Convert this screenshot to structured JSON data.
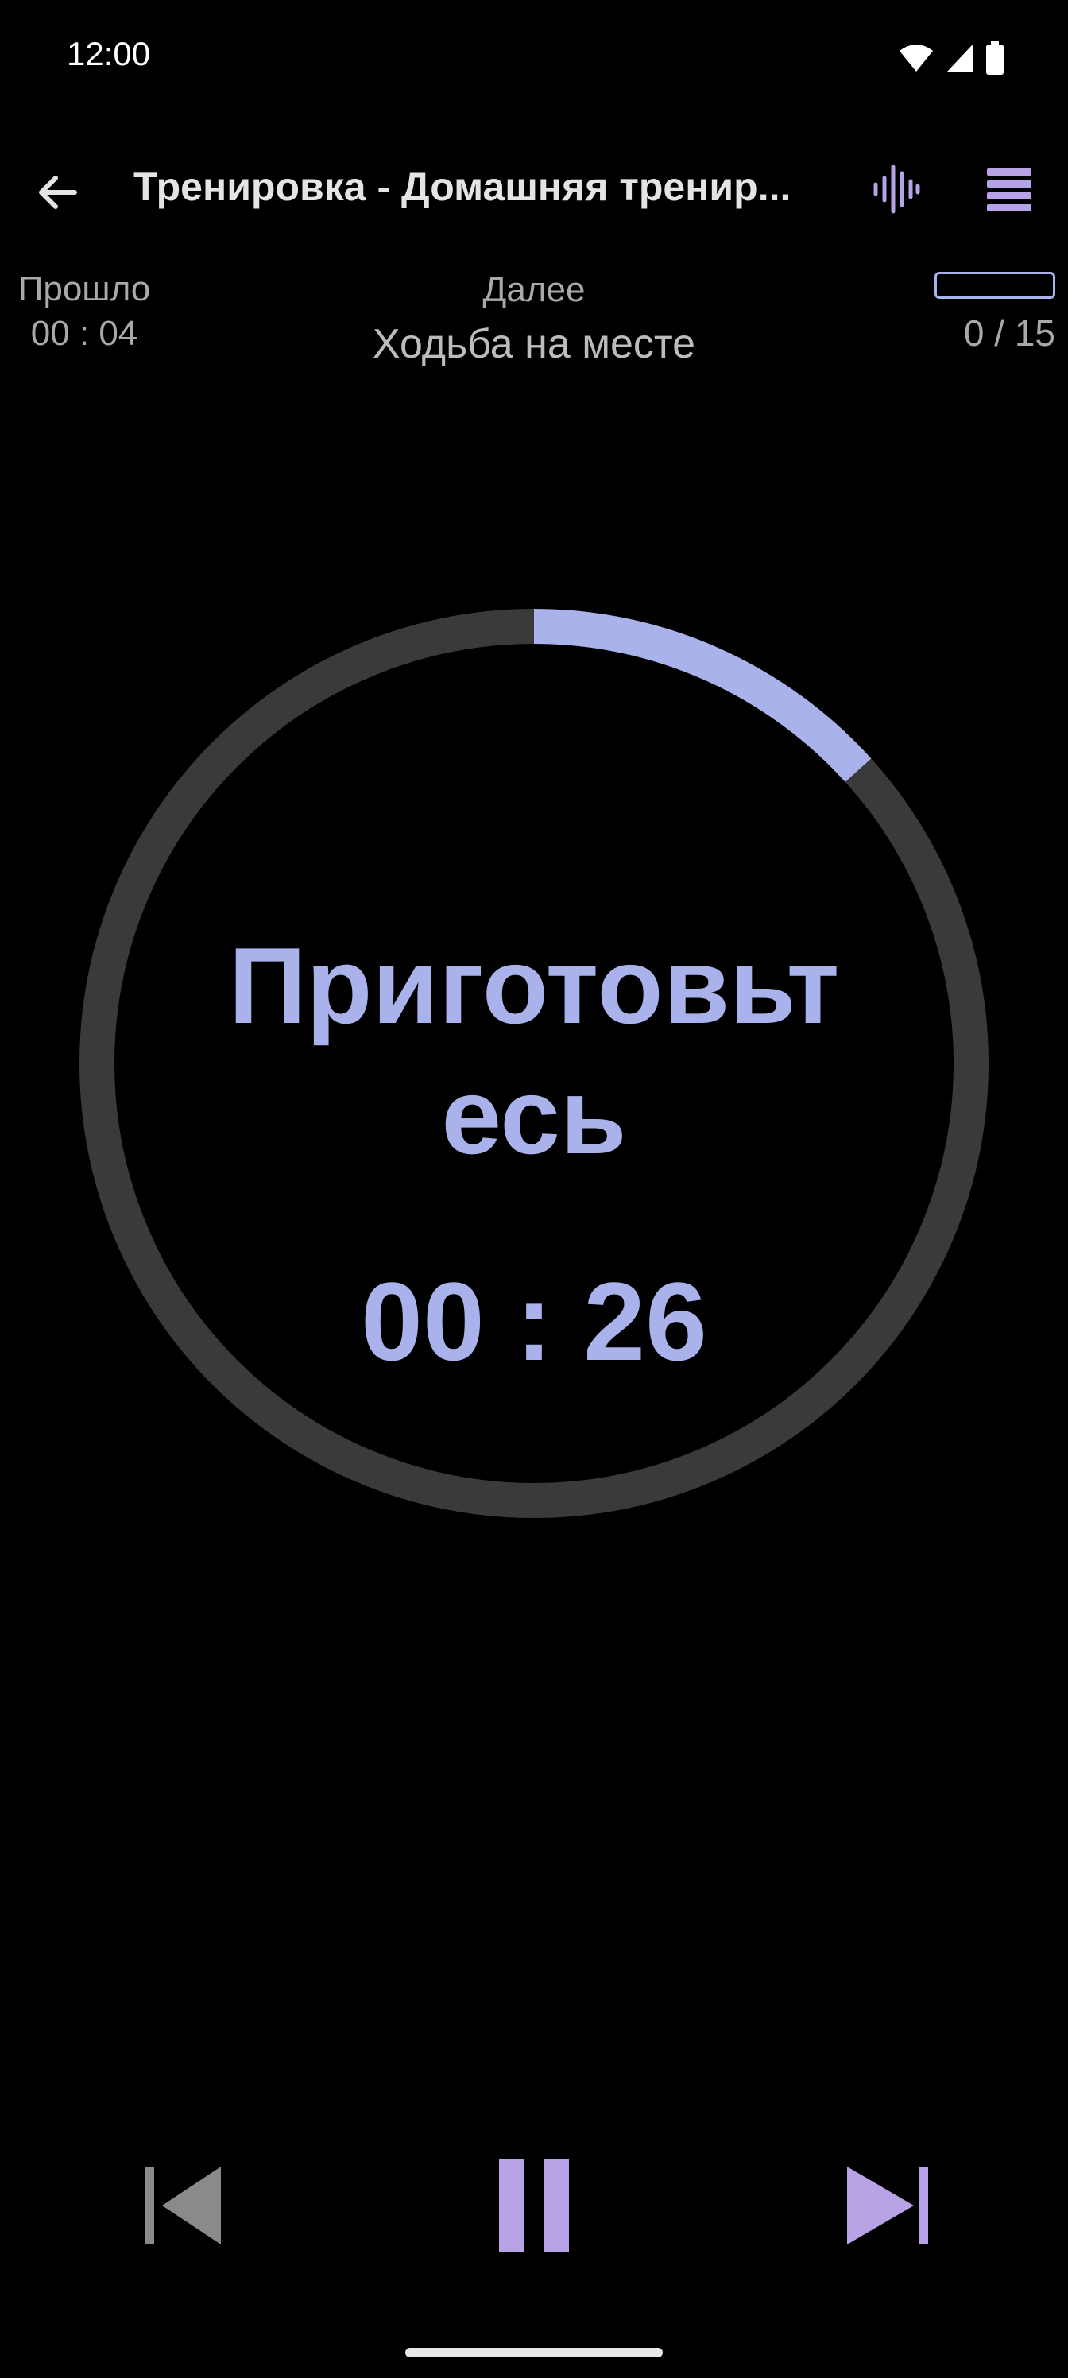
{
  "status_bar": {
    "time": "12:00",
    "icons": [
      "wifi-icon",
      "signal-icon",
      "battery-icon"
    ]
  },
  "app_bar": {
    "title": "Тренировка - Домашняя тренир...",
    "icons": [
      "back-arrow-icon",
      "voice-waveform-icon",
      "menu-list-icon"
    ]
  },
  "info": {
    "elapsed_label": "Прошло",
    "elapsed_value": "00 : 04",
    "next_label": "Далее",
    "next_exercise": "Ходьба на месте",
    "progress_count": "0 / 15",
    "progress_fraction": 0
  },
  "timer": {
    "phase_line1": "Приготовьт",
    "phase_line2": "есь",
    "countdown": "00 : 26",
    "ring_progress_fraction": 0.133
  },
  "controls": {
    "icons": [
      "skip-previous-icon",
      "pause-icon",
      "skip-next-icon"
    ]
  },
  "colors": {
    "background": "#000000",
    "accent": "#a9b2ea",
    "accent_purple": "#b7a3e6",
    "ring_track": "#3a3a3a",
    "muted_text": "#a9a9a9",
    "disabled_icon": "#8a8a8a"
  }
}
